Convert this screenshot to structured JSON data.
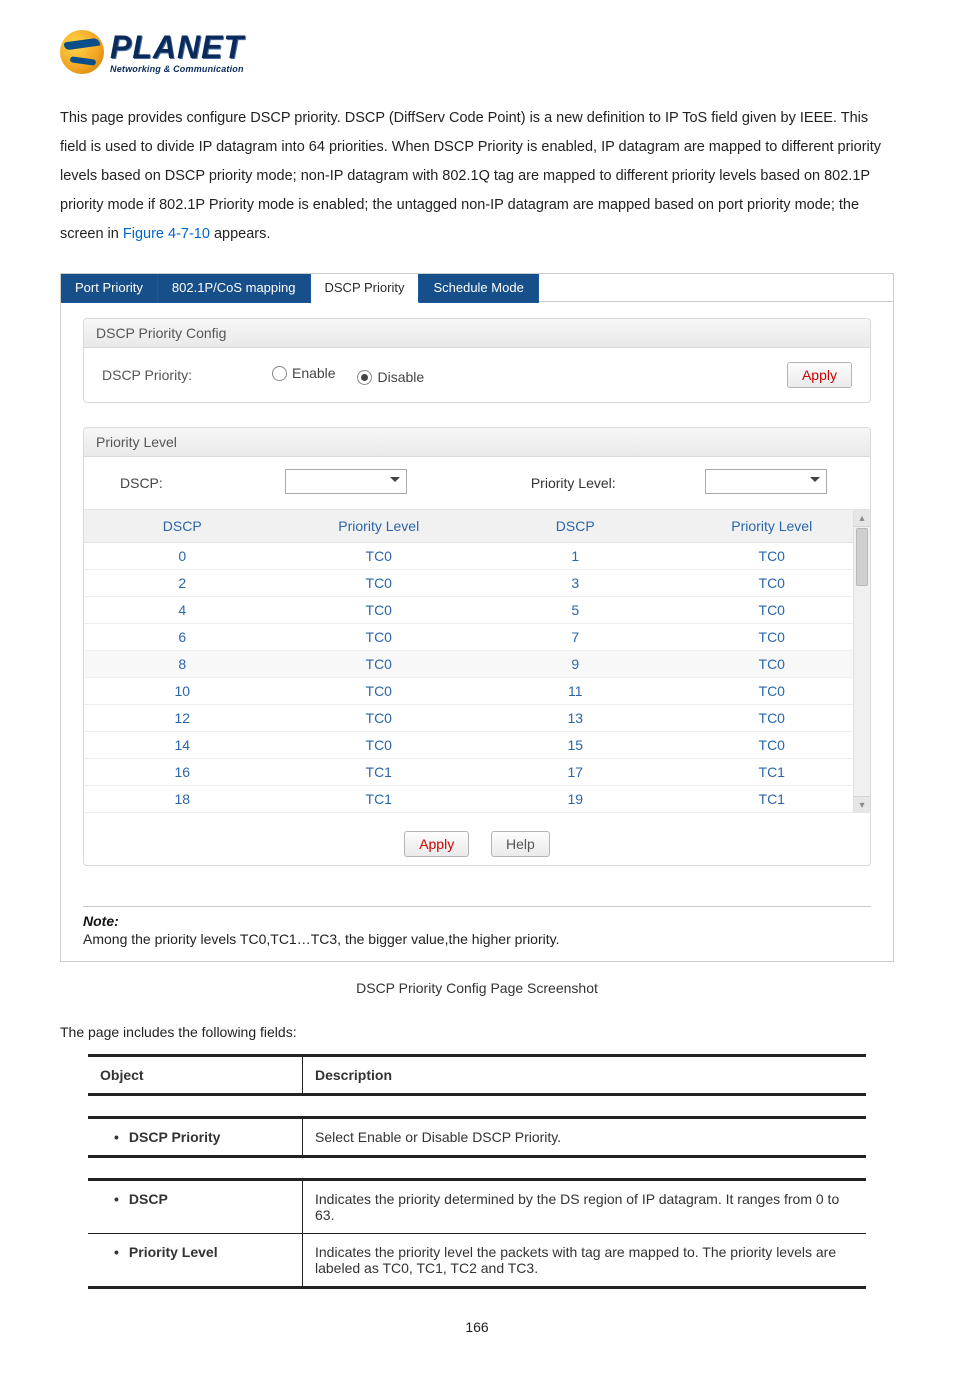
{
  "logo": {
    "brand": "PLANET",
    "tagline": "Networking & Communication"
  },
  "intro": {
    "text": "This page provides configure DSCP priority. DSCP (DiffServ Code Point) is a new definition to IP ToS field given by IEEE. This field is used to divide IP datagram into 64 priorities. When DSCP Priority is enabled, IP datagram are mapped to different priority levels based on DSCP priority mode; non-IP datagram with 802.1Q tag are mapped to different priority levels based on 802.1P priority mode if 802.1P Priority mode is enabled; the untagged non-IP datagram are mapped based on port priority mode; the screen in ",
    "figref": "Figure 4-7-10",
    "tail": " appears."
  },
  "tabs": [
    "Port Priority",
    "802.1P/CoS mapping",
    "DSCP Priority",
    "Schedule Mode"
  ],
  "activeTab": 2,
  "dscpConfig": {
    "sectionTitle": "DSCP Priority Config",
    "label": "DSCP Priority:",
    "enable": "Enable",
    "disable": "Disable",
    "selected": "Disable",
    "apply": "Apply"
  },
  "priorityLevel": {
    "sectionTitle": "Priority Level",
    "dscpLabel": "DSCP:",
    "plLabel": "Priority Level:",
    "header": [
      "DSCP",
      "Priority Level",
      "DSCP",
      "Priority Level"
    ],
    "rows": [
      {
        "a": "0",
        "al": "TC0",
        "b": "1",
        "bl": "TC0"
      },
      {
        "a": "2",
        "al": "TC0",
        "b": "3",
        "bl": "TC0"
      },
      {
        "a": "4",
        "al": "TC0",
        "b": "5",
        "bl": "TC0"
      },
      {
        "a": "6",
        "al": "TC0",
        "b": "7",
        "bl": "TC0"
      },
      {
        "a": "8",
        "al": "TC0",
        "b": "9",
        "bl": "TC0"
      },
      {
        "a": "10",
        "al": "TC0",
        "b": "11",
        "bl": "TC0"
      },
      {
        "a": "12",
        "al": "TC0",
        "b": "13",
        "bl": "TC0"
      },
      {
        "a": "14",
        "al": "TC0",
        "b": "15",
        "bl": "TC0"
      },
      {
        "a": "16",
        "al": "TC1",
        "b": "17",
        "bl": "TC1"
      },
      {
        "a": "18",
        "al": "TC1",
        "b": "19",
        "bl": "TC1"
      }
    ],
    "apply": "Apply",
    "help": "Help"
  },
  "note": {
    "title": "Note:",
    "text": "Among the priority levels TC0,TC1…TC3, the bigger value,the higher priority."
  },
  "caption": "DSCP Priority Config Page Screenshot",
  "fieldsIntro": "The page includes the following fields:",
  "fieldsHeader": [
    "Object",
    "Description"
  ],
  "fieldsConfig": [
    {
      "obj": "DSCP Priority",
      "desc": "Select Enable or Disable DSCP Priority."
    }
  ],
  "fieldsPriority": [
    {
      "obj": "DSCP",
      "desc": "Indicates the priority determined by the DS region of IP datagram. It ranges from 0 to 63."
    },
    {
      "obj": "Priority Level",
      "desc": "Indicates the priority level the packets with tag are mapped to. The priority levels are labeled as TC0, TC1, TC2 and TC3."
    }
  ],
  "pageNumber": "166"
}
